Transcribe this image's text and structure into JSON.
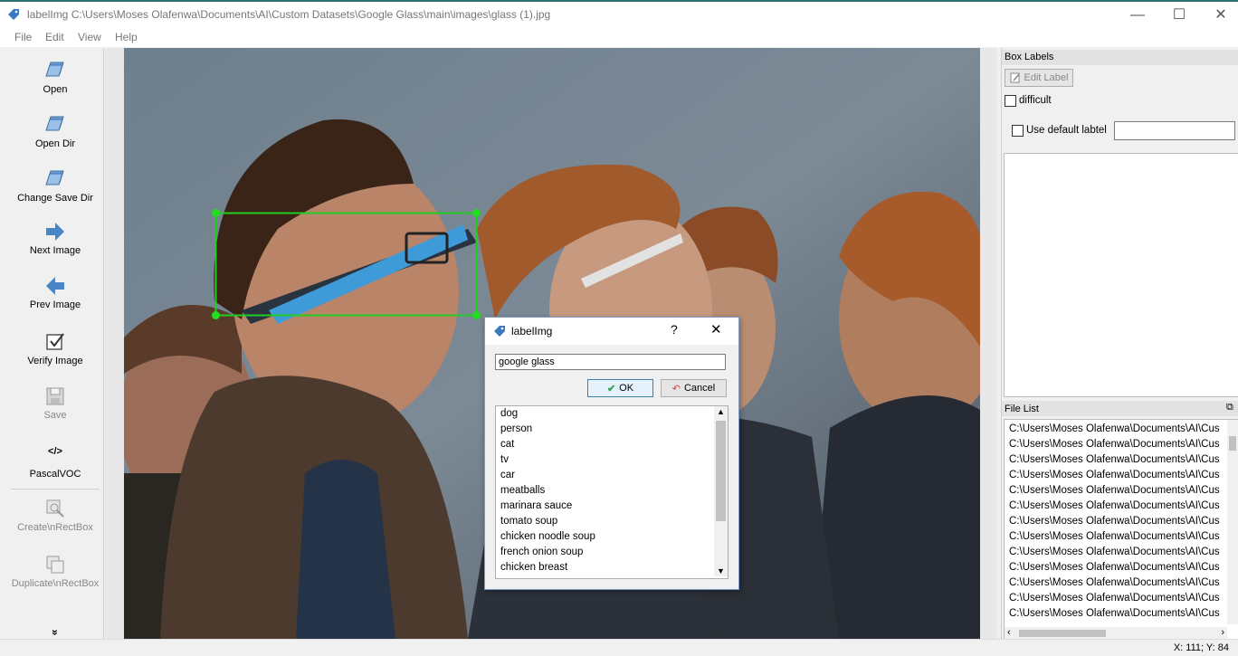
{
  "window": {
    "title": "labelImg C:\\Users\\Moses Olafenwa\\Documents\\AI\\Custom Datasets\\Google Glass\\main\\images\\glass (1).jpg",
    "min_glyph": "—",
    "max_glyph": "☐",
    "close_glyph": "✕"
  },
  "menu": [
    "File",
    "Edit",
    "View",
    "Help"
  ],
  "tools": {
    "open": "Open",
    "open_dir": "Open Dir",
    "change_save_dir": "Change Save Dir",
    "next_image": "Next Image",
    "prev_image": "Prev Image",
    "verify_image": "Verify Image",
    "save": "Save",
    "format_glyph": "</>",
    "format": "PascalVOC",
    "create_rect": "Create\\nRectBox",
    "duplicate_rect": "Duplicate\\nRectBox",
    "more": "»"
  },
  "box_labels": {
    "title": "Box Labels",
    "edit_label": "Edit Label",
    "difficult": "difficult",
    "use_default_label": "Use default labtel",
    "default_label_value": ""
  },
  "file_list": {
    "title": "File List",
    "items": [
      "C:\\Users\\Moses Olafenwa\\Documents\\AI\\Cus",
      "C:\\Users\\Moses Olafenwa\\Documents\\AI\\Cus",
      "C:\\Users\\Moses Olafenwa\\Documents\\AI\\Cus",
      "C:\\Users\\Moses Olafenwa\\Documents\\AI\\Cus",
      "C:\\Users\\Moses Olafenwa\\Documents\\AI\\Cus",
      "C:\\Users\\Moses Olafenwa\\Documents\\AI\\Cus",
      "C:\\Users\\Moses Olafenwa\\Documents\\AI\\Cus",
      "C:\\Users\\Moses Olafenwa\\Documents\\AI\\Cus",
      "C:\\Users\\Moses Olafenwa\\Documents\\AI\\Cus",
      "C:\\Users\\Moses Olafenwa\\Documents\\AI\\Cus",
      "C:\\Users\\Moses Olafenwa\\Documents\\AI\\Cus",
      "C:\\Users\\Moses Olafenwa\\Documents\\AI\\Cus",
      "C:\\Users\\Moses Olafenwa\\Documents\\AI\\Cus"
    ]
  },
  "status": {
    "coords": "X: 111; Y: 84"
  },
  "dialog": {
    "title": "labelImg",
    "help_glyph": "?",
    "close_glyph": "✕",
    "input_value": "google glass",
    "ok_label": "OK",
    "cancel_label": "Cancel",
    "label_options": [
      "dog",
      "person",
      "cat",
      "tv",
      "car",
      "meatballs",
      "marinara sauce",
      "tomato soup",
      "chicken noodle soup",
      "french onion soup",
      "chicken breast"
    ]
  },
  "colors": {
    "bbox": "#22cc22",
    "accent": "#2d6d6b",
    "tool_icon": "#4a86c5"
  }
}
